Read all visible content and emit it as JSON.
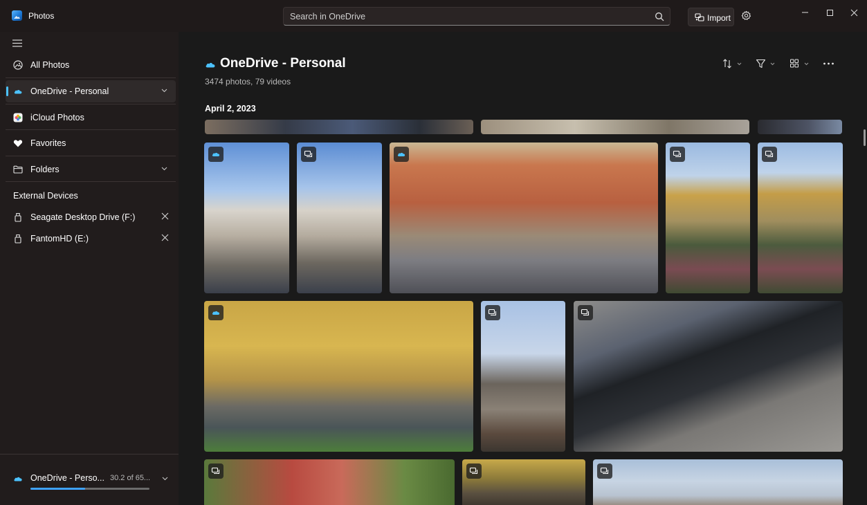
{
  "app": {
    "title": "Photos"
  },
  "search": {
    "text": "Search in OneDrive"
  },
  "toolbar": {
    "import_label": "Import"
  },
  "sidebar": {
    "items": [
      {
        "label": "All Photos"
      },
      {
        "label": "OneDrive - Personal"
      },
      {
        "label": "iCloud Photos"
      },
      {
        "label": "Favorites"
      },
      {
        "label": "Folders"
      }
    ],
    "external_title": "External Devices",
    "devices": [
      {
        "label": "Seagate Desktop Drive (F:)"
      },
      {
        "label": "FantomHD (E:)"
      }
    ],
    "storage": {
      "label": "OneDrive - Perso...",
      "amount": "30.2 of 65...",
      "used_fraction": 0.46
    }
  },
  "main": {
    "title": "OneDrive - Personal",
    "subtitle": "3474 photos, 79 videos",
    "date": "April 2, 2023"
  },
  "colors": {
    "accent": "#4cc2ff",
    "progress": "#3ea2ff",
    "cloud": "#4cc2ff"
  },
  "icons": {
    "badges": [
      "cloud-icon",
      "stack-icon"
    ]
  }
}
